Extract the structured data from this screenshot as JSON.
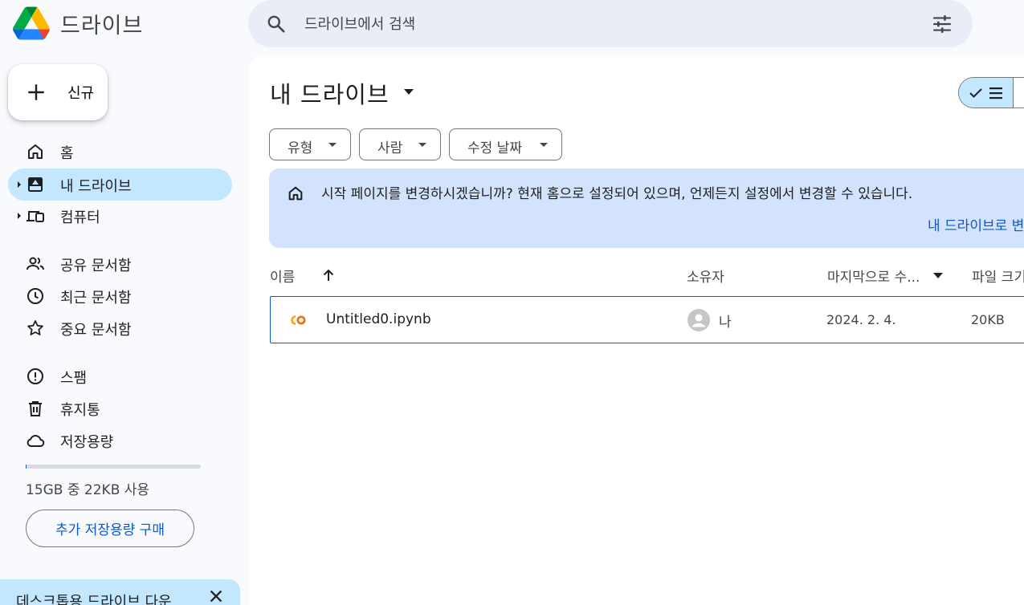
{
  "app": {
    "name": "드라이브"
  },
  "search": {
    "placeholder": "드라이브에서 검색"
  },
  "new_button": {
    "label": "신규"
  },
  "sidebar": {
    "items": [
      {
        "label": "홈",
        "icon": "home-icon"
      },
      {
        "label": "내 드라이브",
        "icon": "drive-icon",
        "active": true
      },
      {
        "label": "컴퓨터",
        "icon": "computers-icon"
      },
      {
        "label": "공유 문서함",
        "icon": "people-icon"
      },
      {
        "label": "최근 문서함",
        "icon": "clock-icon"
      },
      {
        "label": "중요 문서함",
        "icon": "star-icon"
      },
      {
        "label": "스팸",
        "icon": "spam-icon"
      },
      {
        "label": "휴지통",
        "icon": "trash-icon"
      },
      {
        "label": "저장용량",
        "icon": "cloud-icon"
      }
    ]
  },
  "storage": {
    "text": "15GB 중 22KB 사용",
    "buy_label": "추가 저장용량 구매",
    "used_fraction": 1e-06
  },
  "promo": {
    "text": "데스크톱용 드라이브 다운"
  },
  "main": {
    "title": "내 드라이브",
    "filters": [
      "유형",
      "사람",
      "수정 날짜"
    ],
    "banner": {
      "text": "시작 페이지를 변경하시겠습니까? 현재 홈으로 설정되어 있으며, 언제든지 설정에서 변경할 수 있습니다.",
      "link": "내 드라이브로 변"
    },
    "columns": {
      "name": "이름",
      "owner": "소유자",
      "modified": "마지막으로 수...",
      "size": "파일 크기"
    },
    "rows": [
      {
        "name": "Untitled0.ipynb",
        "owner": "나",
        "modified": "2024. 2. 4.",
        "size": "20KB"
      }
    ]
  },
  "colors": {
    "accent": "#0b57d0",
    "active_bg": "#c2e7ff",
    "banner_bg": "#d3e3fd",
    "search_bg": "#e9eef6"
  }
}
